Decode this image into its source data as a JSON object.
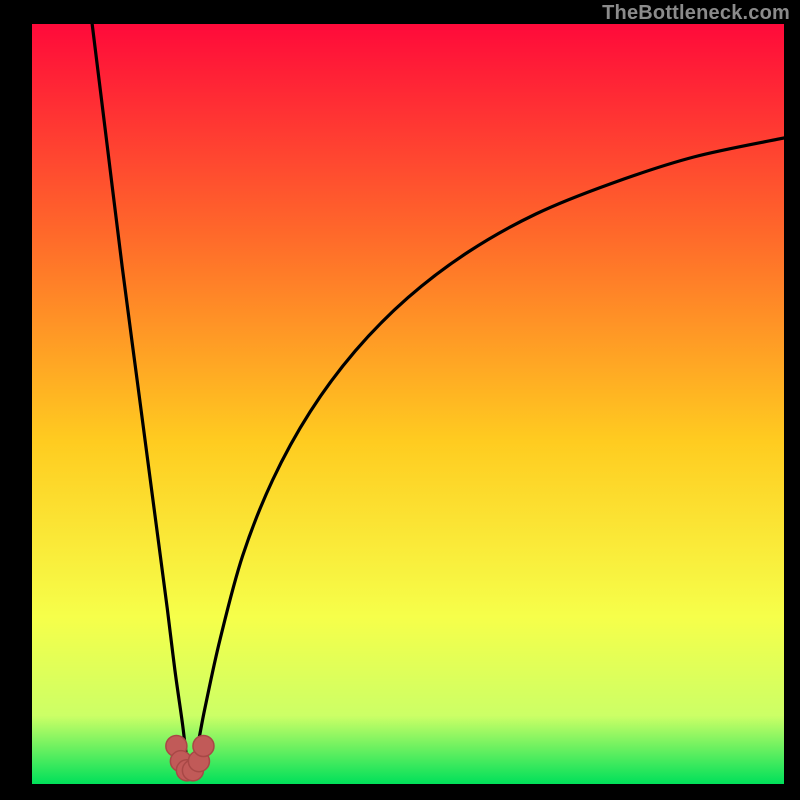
{
  "watermark": "TheBottleneck.com",
  "colors": {
    "frame": "#000000",
    "gradient_top": "#ff0a3a",
    "gradient_mid1": "#ff6a2a",
    "gradient_mid2": "#ffcc20",
    "gradient_mid3": "#f6ff4a",
    "gradient_mid4": "#ccff66",
    "gradient_bottom": "#00e05a",
    "curve": "#000000",
    "marker_fill": "#c15a58",
    "marker_stroke": "#a84846"
  },
  "chart_data": {
    "type": "line",
    "title": "",
    "xlabel": "",
    "ylabel": "",
    "xlim": [
      0,
      100
    ],
    "ylim": [
      0,
      100
    ],
    "x_optimum": 21,
    "series": [
      {
        "name": "left-branch",
        "x": [
          8,
          10,
          12,
          14,
          16,
          18,
          19,
          20,
          20.5,
          21
        ],
        "y": [
          100,
          84,
          68,
          53,
          38,
          23,
          15,
          8,
          4,
          1.5
        ]
      },
      {
        "name": "right-branch",
        "x": [
          21,
          22,
          23,
          25,
          28,
          32,
          37,
          43,
          50,
          58,
          67,
          77,
          88,
          100
        ],
        "y": [
          1.5,
          5,
          10,
          19,
          30,
          40,
          49,
          57,
          64,
          70,
          75,
          79,
          82.5,
          85
        ]
      }
    ],
    "markers": {
      "name": "optimum-markers",
      "points": [
        {
          "x": 19.2,
          "y": 5.0
        },
        {
          "x": 19.8,
          "y": 3.0
        },
        {
          "x": 20.6,
          "y": 1.8
        },
        {
          "x": 21.4,
          "y": 1.8
        },
        {
          "x": 22.2,
          "y": 3.0
        },
        {
          "x": 22.8,
          "y": 5.0
        }
      ],
      "radius_pct": 1.4
    }
  }
}
